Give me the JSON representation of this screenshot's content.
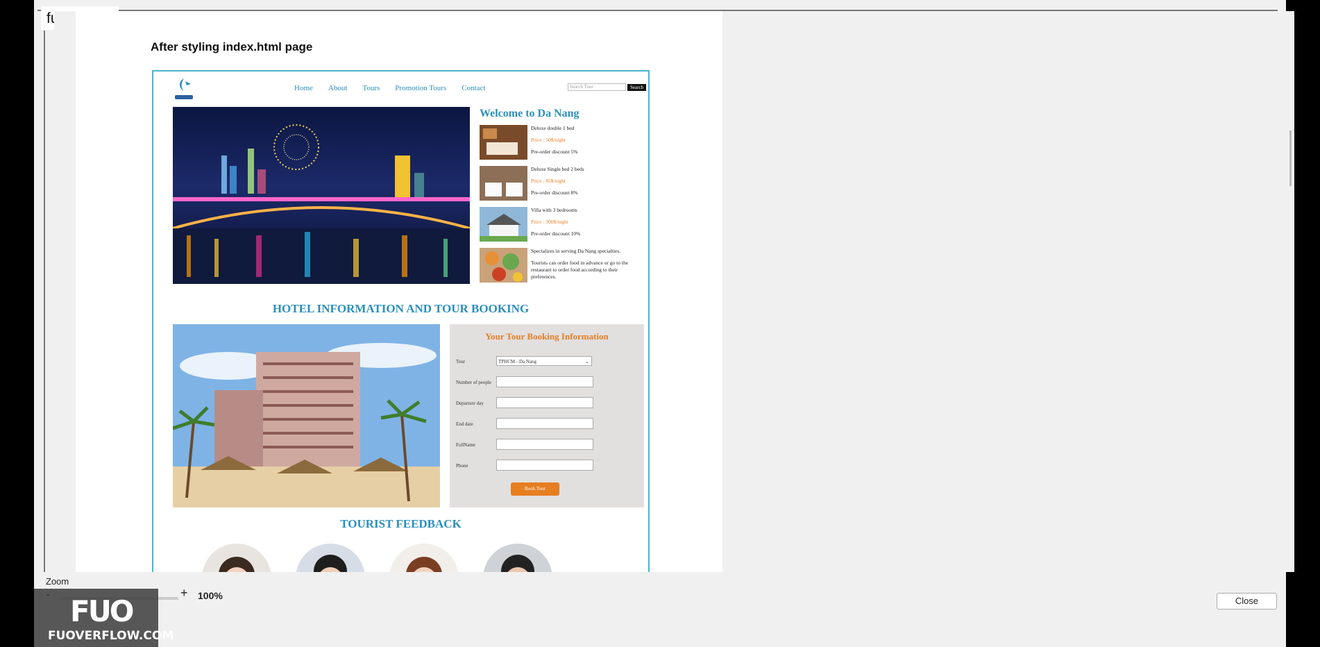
{
  "app": {
    "brand": "fuoverflow"
  },
  "document": {
    "title": "After styling index.html page"
  },
  "site": {
    "nav": [
      "Home",
      "About",
      "Tours",
      "Promotion Tours",
      "Contact"
    ],
    "search": {
      "placeholder": "Search Tour",
      "button": "Search"
    },
    "welcome": "Welcome to Da Nang",
    "rooms": [
      {
        "name": "Deluxe double 1 bed",
        "price": "Price : 50$/night",
        "discount": "Pre-order discount 5%"
      },
      {
        "name": "Deluxe Single bed 2 beds",
        "price": "Price : 85$/night",
        "discount": "Pre-order discount 8%"
      },
      {
        "name": "Villa with 3 bedrooms",
        "price": "Price : 300$/night",
        "discount": "Pre-order discount 10%"
      }
    ],
    "food": {
      "line1": "Specializes in serving Da Nang specialties.",
      "line2": "Tourists can order food in advance or go to the restaurant to order food according to their preferences."
    },
    "section_hotel": "HOTEL INFORMATION AND TOUR BOOKING",
    "booking": {
      "title": "Your Tour Booking Information",
      "fields": [
        {
          "label": "Tour",
          "value": "TPHCM - Da Nang"
        },
        {
          "label": "Number of people",
          "value": ""
        },
        {
          "label": "Departure day",
          "value": ""
        },
        {
          "label": "End date",
          "value": ""
        },
        {
          "label": "FullName",
          "value": ""
        },
        {
          "label": "Phone",
          "value": ""
        }
      ],
      "button": "Book Tour"
    },
    "section_feedback": "TOURIST FEEDBACK"
  },
  "zoom": {
    "label": "Zoom",
    "minus": "-",
    "plus": "+",
    "value": "100%"
  },
  "watermark": {
    "logo": "FUO",
    "text": "FUOVERFLOW.COM"
  },
  "close_label": "Close",
  "colors": {
    "accent": "#2a8fbd",
    "orange": "#e67e22",
    "border": "#4bb3cf"
  }
}
